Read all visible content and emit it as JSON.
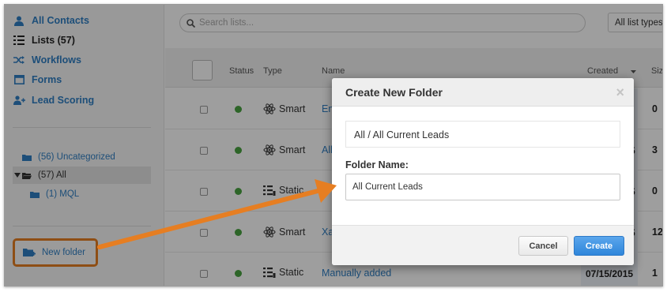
{
  "sidebar": {
    "nav": [
      {
        "label": "All Contacts",
        "icon": "person-icon"
      },
      {
        "label": "Lists (57)",
        "icon": "list-icon"
      },
      {
        "label": "Workflows",
        "icon": "shuffle-icon"
      },
      {
        "label": "Forms",
        "icon": "form-icon"
      },
      {
        "label": "Lead Scoring",
        "icon": "lead-scoring-icon"
      }
    ],
    "folders": [
      {
        "label": "(56) Uncategorized"
      },
      {
        "label": "(57) All"
      },
      {
        "label": "(1) MQL"
      }
    ],
    "new_folder_label": "New folder"
  },
  "toolbar": {
    "search_placeholder": "Search lists...",
    "types_filter": "All list types"
  },
  "table": {
    "headers": {
      "status": "Status",
      "type": "Type",
      "name": "Name",
      "created": "Created",
      "size": "Siz"
    },
    "rows": [
      {
        "type": "Smart",
        "name": "Em",
        "date": "",
        "size": "0"
      },
      {
        "type": "Smart",
        "name": "All",
        "date": "5",
        "size": "3"
      },
      {
        "type": "Static",
        "name": "",
        "date": "5",
        "size": "0"
      },
      {
        "type": "Smart",
        "name": "Xa",
        "date": "5",
        "size": "12"
      },
      {
        "type": "Static",
        "name": "Manually added",
        "date": "07/15/2015",
        "size": "1"
      }
    ]
  },
  "modal": {
    "title": "Create New Folder",
    "close": "×",
    "path": "All / All Current Leads",
    "field_label": "Folder Name:",
    "field_value": "All Current Leads",
    "cancel_label": "Cancel",
    "create_label": "Create"
  },
  "colors": {
    "accent": "#2f7fc3",
    "status_green": "#4aa341",
    "annotation_orange": "#e67e22",
    "primary_button": "#2f86da"
  }
}
